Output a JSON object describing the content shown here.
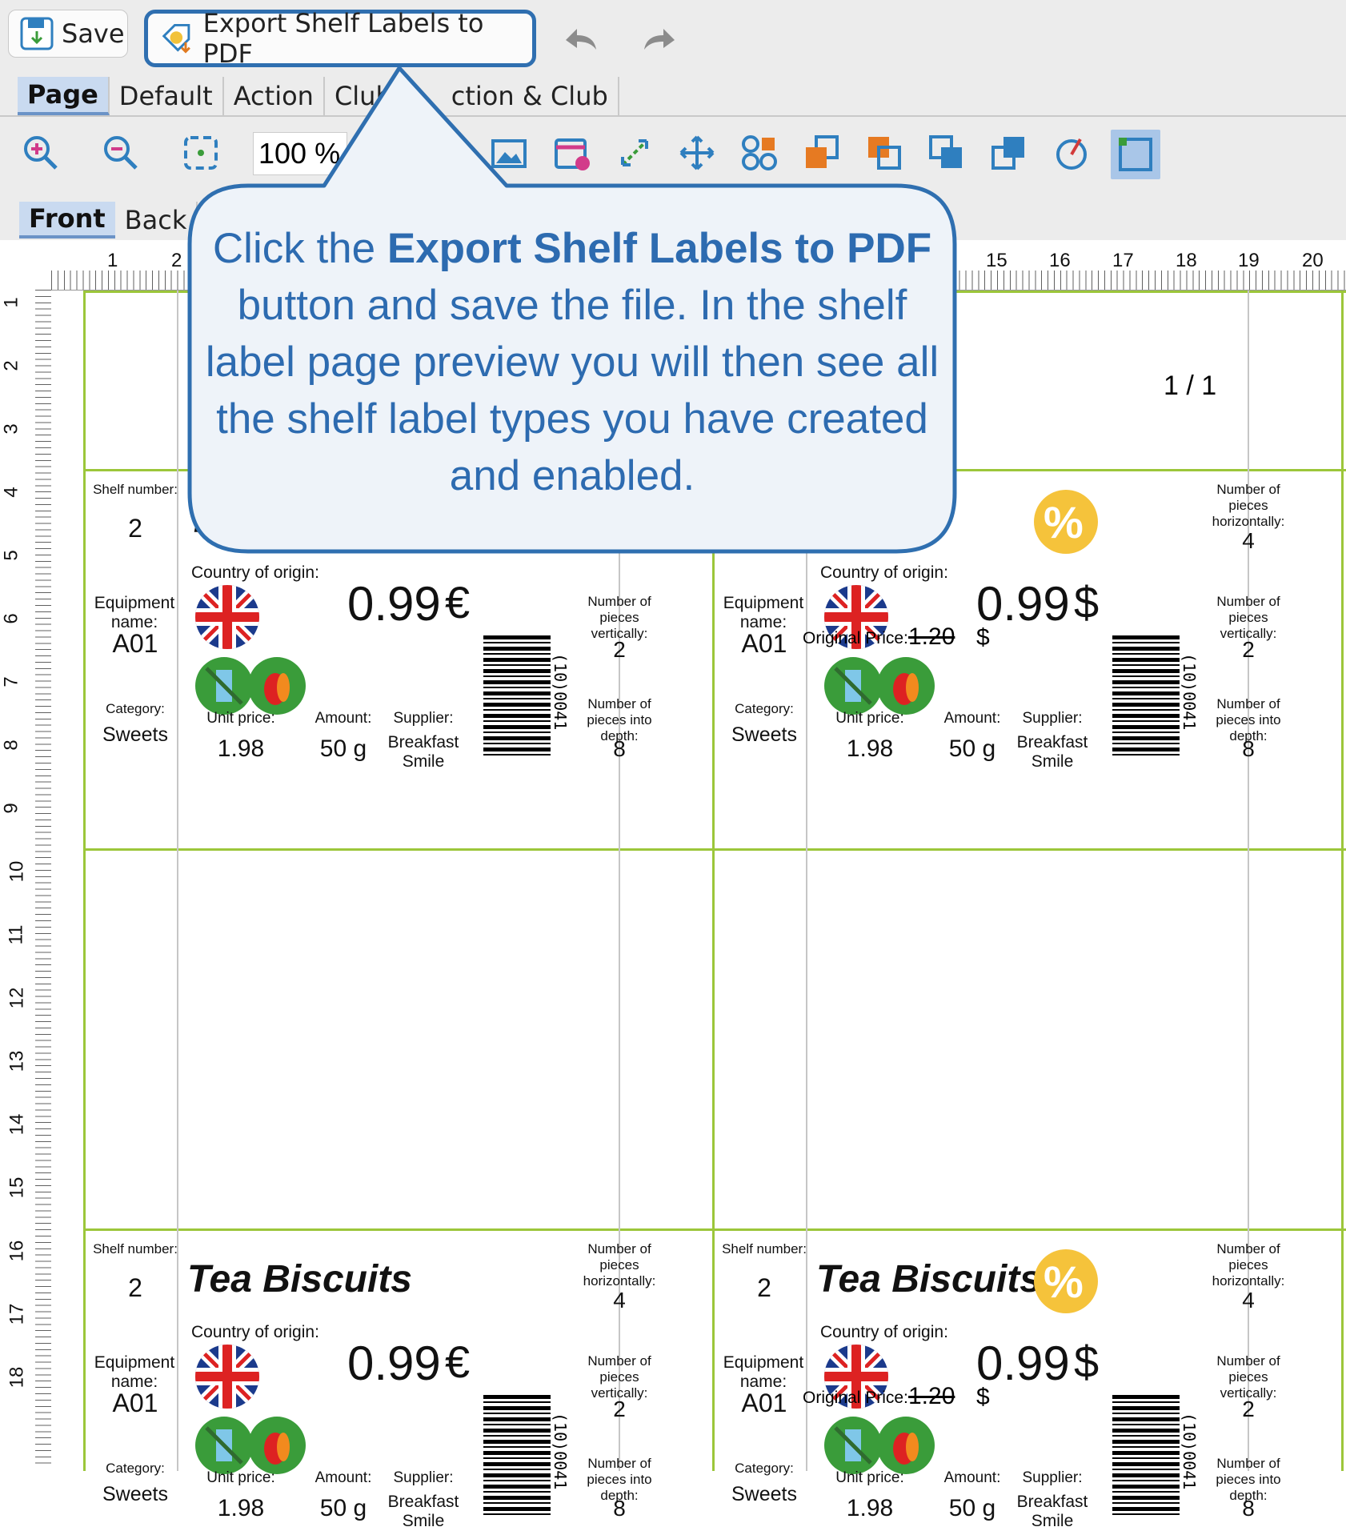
{
  "toolbar": {
    "save_label": "Save",
    "export_label": "Export Shelf Labels to PDF",
    "zoom_value": "100 %"
  },
  "tabs": [
    {
      "label": "Page",
      "selected": true
    },
    {
      "label": "Default",
      "selected": false
    },
    {
      "label": "Action",
      "selected": false
    },
    {
      "label": "Club",
      "selected": false
    },
    {
      "label": "ction & Club",
      "selected": false
    }
  ],
  "side_tabs": {
    "front": "Front",
    "back": "Back"
  },
  "ruler": {
    "top": [
      "1",
      "2",
      "15",
      "16",
      "17",
      "18",
      "19",
      "20"
    ],
    "left": [
      "1",
      "2",
      "3",
      "4",
      "5",
      "6",
      "7",
      "8",
      "9",
      "10",
      "11",
      "12",
      "13",
      "14",
      "15",
      "16",
      "17",
      "18"
    ]
  },
  "callout": {
    "part1": "Click the ",
    "bold": "Export Shelf Labels to PDF",
    "part2": " button and save the file. In the shelf label page preview you will then see all the shelf label types you have created and enabled."
  },
  "page_counter": "1 / 1",
  "labels": {
    "shelf_number_label": "Shelf number:",
    "shelf_number": "2",
    "equipment_label": "Equipment name:",
    "equipment": "A01",
    "category_label": "Category:",
    "category": "Sweets",
    "product_name": "Tea Biscuits",
    "product_name_partial": "scuits",
    "country_label": "Country of origin:",
    "price": "0.99",
    "currency_eur": "€",
    "currency_usd": "$",
    "original_price_label": "Original Price:",
    "original_price": "1.20",
    "unit_price_label": "Unit price:",
    "unit_price": "1.98",
    "amount_label": "Amount:",
    "amount": "50 g",
    "supplier_label": "Supplier:",
    "supplier": "Breakfast Smile",
    "pieces_horizontal_label": "Number of pieces horizontally:",
    "pieces_horizontal": "4",
    "pieces_vertical_label": "Number of pieces vertically:",
    "pieces_vertical": "2",
    "pieces_depth_label": "Number of pieces into depth:",
    "pieces_depth": "8",
    "barcode_text": "(10)0041",
    "discount_symbol": "%"
  },
  "colors": {
    "accent": "#2f6fb0",
    "callout_bg": "#eef3f9",
    "label_border": "#9cc63a",
    "discount_badge": "#f5c33b"
  }
}
